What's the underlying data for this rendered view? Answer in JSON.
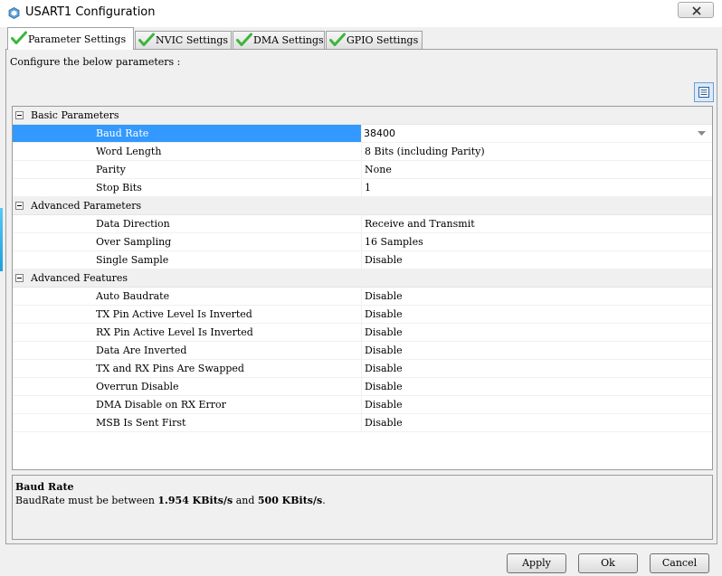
{
  "window": {
    "title": "USART1 Configuration"
  },
  "tabs": [
    {
      "label": "Parameter Settings",
      "active": true
    },
    {
      "label": "NVIC Settings",
      "active": false
    },
    {
      "label": "DMA Settings",
      "active": false
    },
    {
      "label": "GPIO Settings",
      "active": false
    }
  ],
  "intro_text": "Configure the below parameters :",
  "groups": [
    {
      "label": "Basic Parameters",
      "params": [
        {
          "name": "Baud Rate",
          "value": "38400"
        },
        {
          "name": "Word Length",
          "value": "8 Bits (including Parity)"
        },
        {
          "name": "Parity",
          "value": "None"
        },
        {
          "name": "Stop Bits",
          "value": "1"
        }
      ]
    },
    {
      "label": "Advanced Parameters",
      "params": [
        {
          "name": "Data Direction",
          "value": "Receive and Transmit"
        },
        {
          "name": "Over Sampling",
          "value": "16 Samples"
        },
        {
          "name": "Single Sample",
          "value": "Disable"
        }
      ]
    },
    {
      "label": "Advanced Features",
      "params": [
        {
          "name": "Auto Baudrate",
          "value": "Disable"
        },
        {
          "name": "TX Pin Active Level Is Inverted",
          "value": "Disable"
        },
        {
          "name": "RX Pin Active Level Is Inverted",
          "value": "Disable"
        },
        {
          "name": "Data Are Inverted",
          "value": "Disable"
        },
        {
          "name": "TX and RX Pins Are Swapped",
          "value": "Disable"
        },
        {
          "name": "Overrun Disable",
          "value": "Disable"
        },
        {
          "name": "DMA Disable on RX Error",
          "value": "Disable"
        },
        {
          "name": "MSB Is Sent First",
          "value": "Disable"
        }
      ]
    }
  ],
  "description": {
    "title": "Baud Rate",
    "text_prefix": "BaudRate must be between ",
    "min_value": "1.954 KBits/s",
    "text_middle": " and ",
    "max_value": "500 KBits/s",
    "text_suffix": "."
  },
  "buttons": {
    "apply": "Apply",
    "ok": "Ok",
    "cancel": "Cancel"
  },
  "colors": {
    "selection": "#3399ff",
    "check": "#3cb53c"
  }
}
